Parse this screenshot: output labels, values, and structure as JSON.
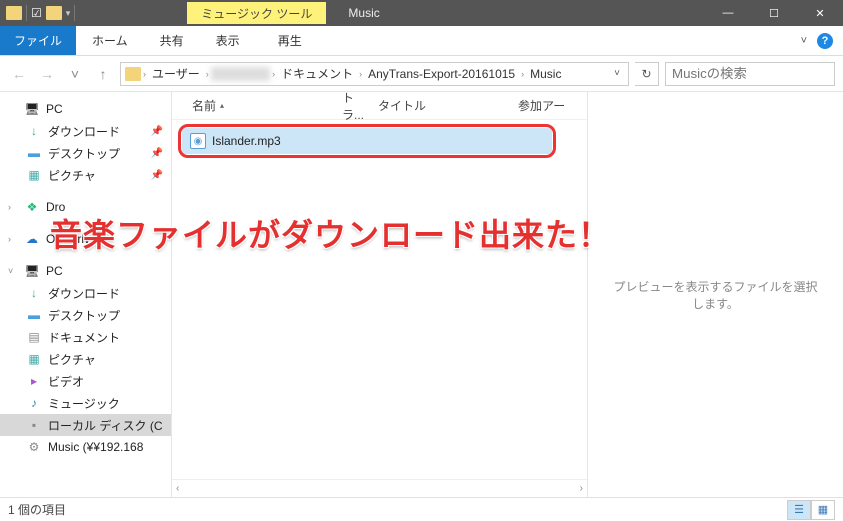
{
  "titlebar": {
    "contextual_tab": "ミュージック ツール",
    "title": "Music",
    "minimize": "—",
    "maximize": "☐",
    "close": "✕"
  },
  "ribbon": {
    "file": "ファイル",
    "tabs": [
      "ホーム",
      "共有",
      "表示"
    ],
    "context_tab": "再生",
    "expand": "˅",
    "help": "?"
  },
  "nav": {
    "back": "←",
    "forward": "→",
    "recent": "˅",
    "up": "↑",
    "crumbs": [
      "ユーザー",
      "",
      "ドキュメント",
      "AnyTrans-Export-20161015",
      "Music"
    ],
    "dropdown": "˅",
    "refresh": "↻",
    "search_placeholder": "Musicの検索"
  },
  "tree": {
    "quick": {
      "label": "PC"
    },
    "items1": [
      {
        "label": "ダウンロード",
        "icon": "ic-dl",
        "pin": true
      },
      {
        "label": "デスクトップ",
        "icon": "ic-desk",
        "pin": true
      },
      {
        "label": "ピクチャ",
        "icon": "ic-pic",
        "pin": true
      }
    ],
    "dropbox": "Dro",
    "onedrive": "OneDrive",
    "pc": "PC",
    "items2": [
      {
        "label": "ダウンロード",
        "icon": "ic-dl"
      },
      {
        "label": "デスクトップ",
        "icon": "ic-desk"
      },
      {
        "label": "ドキュメント",
        "icon": "ic-doc"
      },
      {
        "label": "ピクチャ",
        "icon": "ic-pic"
      },
      {
        "label": "ビデオ",
        "icon": "ic-vid"
      },
      {
        "label": "ミュージック",
        "icon": "ic-mus"
      },
      {
        "label": "ローカル ディスク (C",
        "icon": "ic-disk",
        "selected": true
      },
      {
        "label": "Music (¥¥192.168",
        "icon": "ic-net"
      }
    ]
  },
  "columns": {
    "name": "名前",
    "track": "トラ...",
    "title": "タイトル",
    "artists": "参加アー"
  },
  "file": {
    "name": "Islander.mp3",
    "icon_glyph": "◉"
  },
  "preview": {
    "text": "プレビューを表示するファイルを選択します。"
  },
  "overlay": "音楽ファイルがダウンロード出来た！",
  "status": {
    "count": "1 個の項目"
  }
}
